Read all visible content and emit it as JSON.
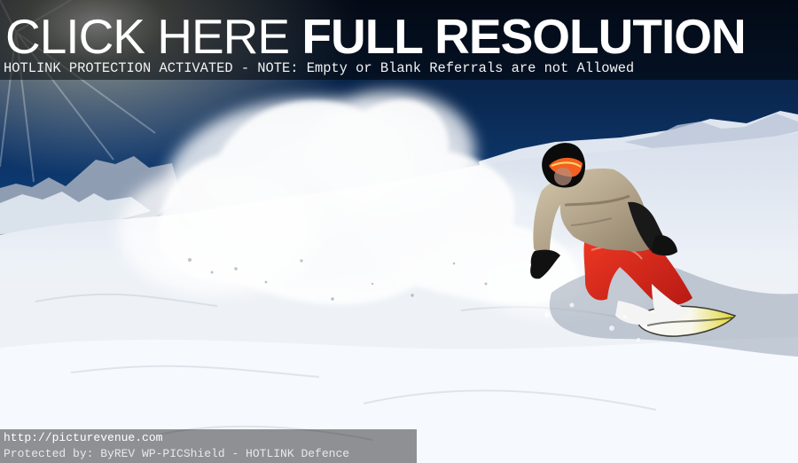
{
  "photo": {
    "description_icon": "snowboarder-photo",
    "sky_color": "#0b2b56",
    "snow_color": "#f4f6fb",
    "pants_color": "#d82a1d",
    "jacket_color": "#b8a98c"
  },
  "banner": {
    "headline_light": "CLICK HERE ",
    "headline_bold": "FULL RESOLUTION",
    "notice": "HOTLINK PROTECTION ACTIVATED - NOTE: Empty or Blank Referrals are not Allowed"
  },
  "footer": {
    "url": "http://picturevenue.com",
    "credit": "Protected by: ByREV WP-PICShield - HOTLINK Defence"
  }
}
